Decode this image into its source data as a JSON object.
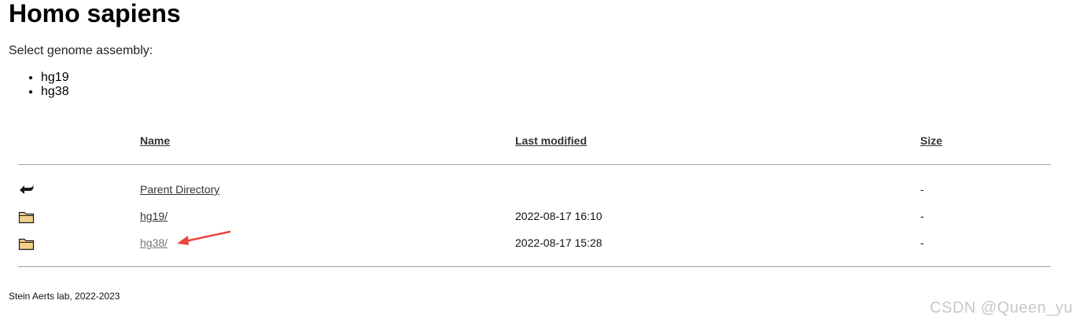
{
  "page": {
    "title": "Homo sapiens",
    "intro": "Select genome assembly:",
    "assemblies": [
      "hg19",
      "hg38"
    ]
  },
  "listing": {
    "columns": {
      "name": "Name",
      "last_modified": "Last modified",
      "size": "Size"
    },
    "rows": [
      {
        "icon": "back-arrow-icon",
        "name": "Parent Directory",
        "last_modified": "",
        "size": "-"
      },
      {
        "icon": "folder-icon",
        "name": "hg19/",
        "last_modified": "2022-08-17 16:10",
        "size": "-"
      },
      {
        "icon": "folder-icon",
        "name": "hg38/",
        "last_modified": "2022-08-17 15:28",
        "size": "-",
        "visited": true
      }
    ]
  },
  "footer": {
    "text": "Stein Aerts lab, 2022-2023"
  },
  "watermark": {
    "text": "CSDN @Queen_yu"
  },
  "colors": {
    "link": "#333333",
    "visited_link": "#777777",
    "rule": "#a0a0a0",
    "annotation_arrow": "#e8453c",
    "folder_fill": "#f3d08a"
  }
}
